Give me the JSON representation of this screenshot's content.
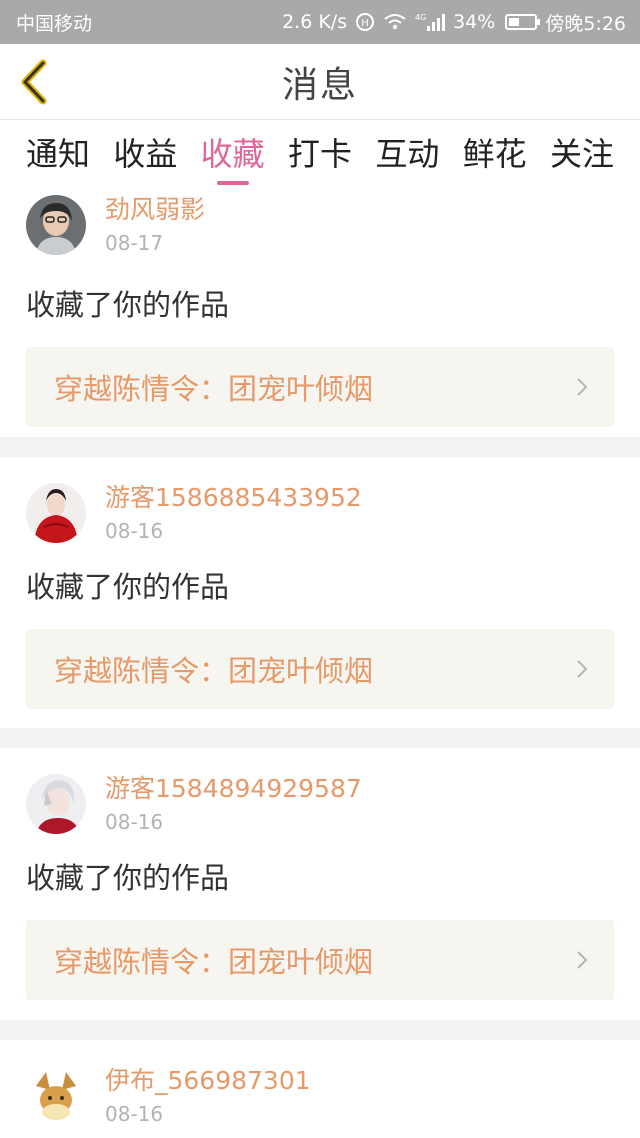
{
  "status_bar": {
    "carrier": "中国移动",
    "speed": "2.6 K/s",
    "network": "4G",
    "battery": "34%",
    "battery_level": 0.34,
    "time": "傍晚5:26"
  },
  "nav": {
    "title": "消息"
  },
  "tabs": [
    "通知",
    "收益",
    "收藏",
    "打卡",
    "互动",
    "鲜花",
    "关注"
  ],
  "active_tab": "收藏",
  "messages": [
    {
      "user": "劲风弱影",
      "date": "08-17",
      "action": "收藏了你的作品",
      "work": "穿越陈情令：团宠叶倾烟"
    },
    {
      "user": "游客1586885433952",
      "date": "08-16",
      "action": "收藏了你的作品",
      "work": "穿越陈情令：团宠叶倾烟"
    },
    {
      "user": "游客1584894929587",
      "date": "08-16",
      "action": "收藏了你的作品",
      "work": "穿越陈情令：团宠叶倾烟"
    },
    {
      "user": "伊布_566987301",
      "date": "08-16"
    }
  ],
  "colors": {
    "accent_pink": "#e0679b",
    "username_orange": "#e69a6a",
    "work_bg": "#f6f5ef",
    "status_bar_bg": "#a9a9a9"
  }
}
